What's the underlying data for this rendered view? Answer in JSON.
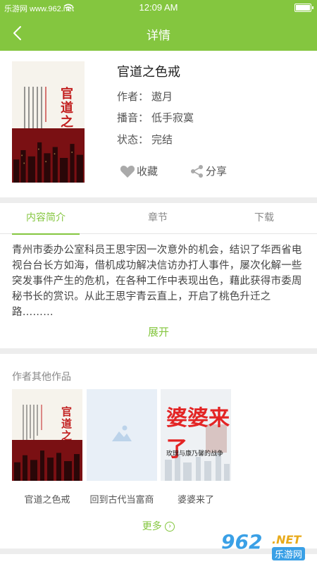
{
  "status_bar": {
    "carrier": "乐游网 www.962.net",
    "time": "12:09 AM"
  },
  "nav": {
    "title": "详情"
  },
  "book": {
    "title": "官道之色戒",
    "cover_title": "官道之色戒",
    "author_label": "作者：",
    "author": "遨月",
    "narrator_label": "播音：",
    "narrator": "低手寂寞",
    "status_label": "状态：",
    "status": "完结",
    "favorite_label": "收藏",
    "share_label": "分享"
  },
  "tabs": [
    {
      "label": "内容简介",
      "active": true
    },
    {
      "label": "章节",
      "active": false
    },
    {
      "label": "下载",
      "active": false
    }
  ],
  "intro": {
    "text": "青州市委办公室科员王思宇因一次意外的机会，结识了华西省电视台台长方如海，借机成功解决信访办打人事件，屡次化解一些突发事件产生的危机，在各种工作中表现出色，藉此获得市委周秘书长的赏识。从此王思宇青云直上，开启了桃色升迁之路………",
    "expand_label": "展开"
  },
  "other_works": {
    "title": "作者其他作品",
    "items": [
      {
        "name": "官道之色戒",
        "cover_title": "官道之色戒"
      },
      {
        "name": "回到古代当富商"
      },
      {
        "name": "婆婆来了",
        "cover_big": "婆婆来了",
        "cover_sub": "玫瑰与康乃馨的战争"
      }
    ],
    "more_label": "更多",
    "more_icon": "›"
  },
  "watermark": {
    "number": "962",
    "net": ".NET",
    "cn": "乐游网"
  },
  "colors": {
    "accent": "#84c63f",
    "cover_red": "#7a1013",
    "title_red": "#c21f1f"
  }
}
